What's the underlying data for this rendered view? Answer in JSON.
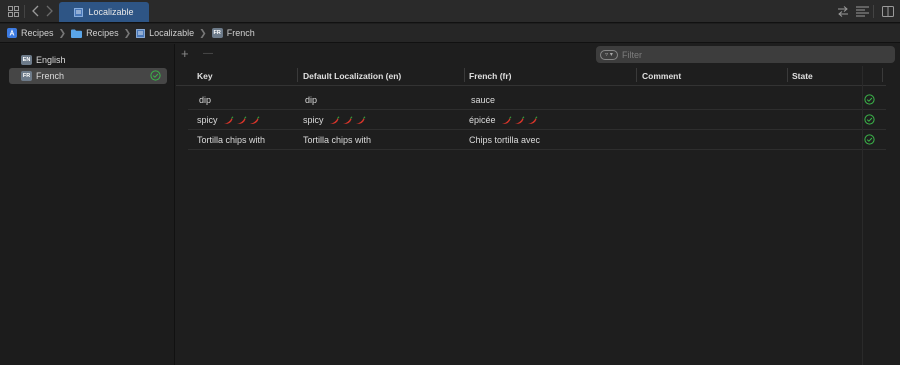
{
  "tabbar": {
    "tab_title": "Localizable",
    "icons": [
      "grid-icon",
      "back-icon",
      "forward-icon",
      "swap-icon",
      "list-icon",
      "inspector-icon"
    ]
  },
  "breadcrumb": {
    "items": [
      "Recipes",
      "Recipes",
      "Localizable",
      "French"
    ],
    "badge": "FR"
  },
  "sidebar": {
    "items": [
      {
        "badge": "EN",
        "label": "English"
      },
      {
        "badge": "FR",
        "label": "French"
      }
    ]
  },
  "toolbar": {
    "add_label": "+",
    "remove_label": "—",
    "filter_placeholder": "Filter"
  },
  "table": {
    "headers": [
      "Key",
      "Default Localization (en)",
      "French (fr)",
      "Comment",
      "State"
    ],
    "rows": [
      {
        "key": "dip",
        "default": "dip",
        "french": "sauce",
        "comment": ""
      },
      {
        "key": "spicy",
        "default": "spicy",
        "french": "épicée",
        "comment": ""
      },
      {
        "key": "Tortilla chips with",
        "default": "Tortilla chips with",
        "french": "Chips tortilla avec",
        "comment": ""
      }
    ]
  },
  "colors": {
    "accent_tab": "#2e5585",
    "state_green": "#3bb54a",
    "chili_red": "#d8352a"
  }
}
